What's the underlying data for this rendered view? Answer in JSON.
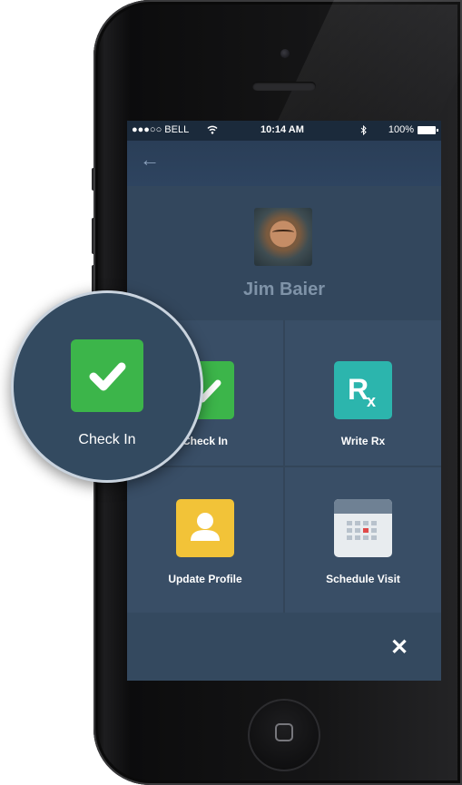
{
  "status_bar": {
    "carrier": "●●●○○ BELL",
    "time": "10:14 AM",
    "battery": "100%"
  },
  "nav": {
    "back_icon": "arrow-left-icon"
  },
  "profile": {
    "name": "Jim Baier"
  },
  "actions": [
    {
      "label": "Check In",
      "icon": "checkmark-icon",
      "color": "#3cb54a"
    },
    {
      "label": "Write Rx",
      "icon": "rx-icon",
      "color": "#2cb5ad"
    },
    {
      "label": "Update Profile",
      "icon": "user-icon",
      "color": "#f2c338"
    },
    {
      "label": "Schedule Visit",
      "icon": "calendar-icon",
      "color": "#e8ecef"
    }
  ],
  "footer": {
    "close_icon": "close-icon"
  },
  "callout": {
    "label": "Check In",
    "icon": "checkmark-icon",
    "color": "#3cb54a"
  }
}
